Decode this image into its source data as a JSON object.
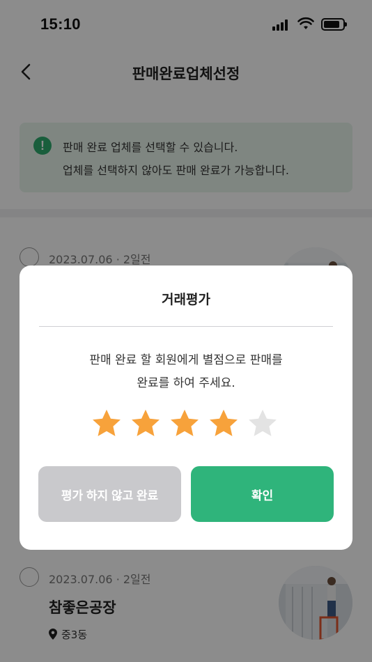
{
  "status_bar": {
    "time": "15:10"
  },
  "header": {
    "title": "판매완료업체선정"
  },
  "notice": {
    "line1": "판매 완료 업체를 선택할 수 있습니다.",
    "line2": "업체를 선택하지 않아도 판매 완료가 가능합니다.",
    "icon_text": "!"
  },
  "list": [
    {
      "date": "2023.07.06 · 2일전"
    },
    {
      "date": "2023.07.06 · 2일전",
      "name": "참좋은공장",
      "location": "중3동"
    }
  ],
  "modal": {
    "title": "거래평가",
    "message_line1": "판매 완료 할 회원에게 별점으로 판매를",
    "message_line2": "완료를 하여 주세요.",
    "rating": 4,
    "max_rating": 5,
    "skip_label": "평가 하지 않고 완료",
    "confirm_label": "확인"
  },
  "colors": {
    "accent": "#2fb47b",
    "star_filled": "#f7a23b",
    "star_empty": "#e3e3e3",
    "notice_bg": "#e8f4ec"
  }
}
